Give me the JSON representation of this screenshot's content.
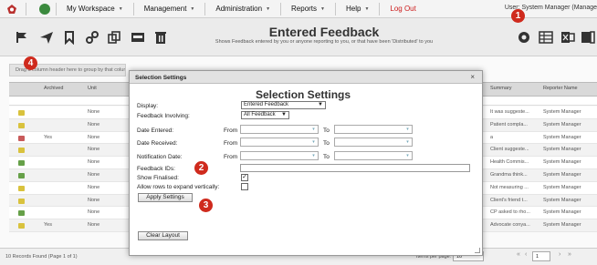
{
  "menubar": {
    "workspace": "My Workspace",
    "management": "Management",
    "administration": "Administration",
    "reports": "Reports",
    "help": "Help",
    "logout": "Log Out",
    "user": "User: System Manager (Manage"
  },
  "toolbar": {
    "title": "Entered Feedback",
    "subtitle": "Shows Feedback entered by you or anyone reporting to you, or that have been 'Distributed' to you"
  },
  "grid": {
    "group_hint": "Drag a column header here to group by that column",
    "columns": {
      "archived": "Archived",
      "unit": "Unit",
      "summary": "Summary",
      "reporter": "Reporter Name"
    },
    "rows": [
      {
        "archived": "",
        "unit": "None",
        "summary": "It was suggeste...",
        "reporter": "System Manager",
        "status": "#d9c23d"
      },
      {
        "archived": "",
        "unit": "None",
        "summary": "Patient compla...",
        "reporter": "System Manager",
        "status": "#d9c23d"
      },
      {
        "archived": "Yes",
        "unit": "None",
        "summary": "a",
        "reporter": "System Manager",
        "status": "#c85a5a"
      },
      {
        "archived": "",
        "unit": "None",
        "summary": "Client suggeste...",
        "reporter": "System Manager",
        "status": "#d9c23d"
      },
      {
        "archived": "",
        "unit": "None",
        "summary": "Health Commis...",
        "reporter": "System Manager",
        "status": "#66a048"
      },
      {
        "archived": "",
        "unit": "None",
        "summary": "Grandma think...",
        "reporter": "System Manager",
        "status": "#66a048"
      },
      {
        "archived": "",
        "unit": "None",
        "summary": "Not measuring ...",
        "reporter": "System Manager",
        "status": "#d9c23d"
      },
      {
        "archived": "",
        "unit": "None",
        "summary": "Client's friend t...",
        "reporter": "System Manager",
        "status": "#d9c23d"
      },
      {
        "archived": "",
        "unit": "None",
        "summary": "CP asked to rho...",
        "reporter": "System Manager",
        "status": "#66a048"
      },
      {
        "archived": "Yes",
        "unit": "None",
        "summary": "Advocate conya...",
        "reporter": "System Manager",
        "status": "#d9c23d"
      }
    ],
    "footer": {
      "count": "10 Records Found (Page 1 of 1)",
      "items_per_page_label": "Items per page:",
      "items_per_page": "10",
      "page": "1"
    }
  },
  "modal": {
    "header": "Selection Settings",
    "close": "×",
    "title": "Selection Settings",
    "display_label": "Display:",
    "display_value": "Entered Feedback",
    "involving_label": "Feedback Involving:",
    "involving_value": "All Feedback",
    "date_entered_label": "Date Entered:",
    "date_received_label": "Date Received:",
    "notification_label": "Notification Date:",
    "from": "From",
    "to": "To",
    "ids_label": "Feedback IDs:",
    "show_finalised_label": "Show Finalised:",
    "allow_rows_label": "Allow rows to expand vertically:",
    "apply_button": "Apply Settings",
    "clear_button": "Clear Layout",
    "show_finalised_checked": true,
    "allow_rows_checked": false
  },
  "callouts": [
    "1",
    "2",
    "3",
    "4"
  ],
  "colors": {
    "callout": "#cf2a1d",
    "logout": "#cc1b1b"
  }
}
